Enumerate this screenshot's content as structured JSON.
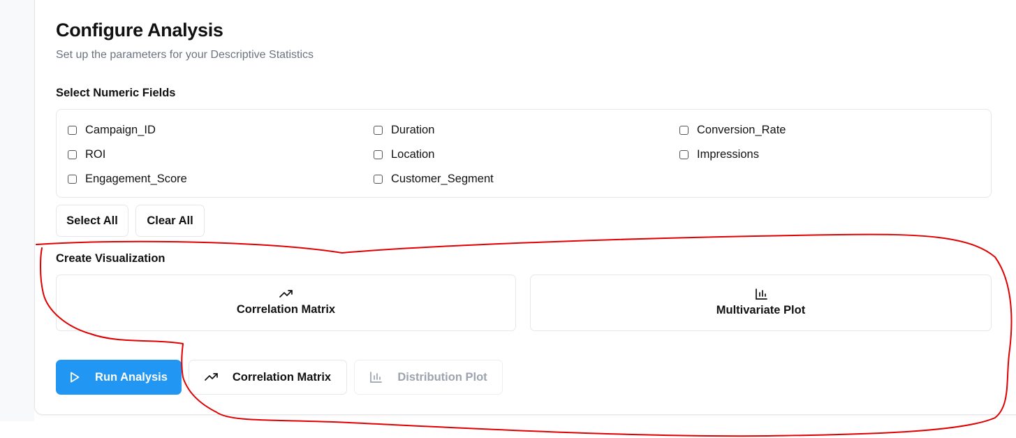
{
  "header": {
    "title": "Configure Analysis",
    "subtitle": "Set up the parameters for your Descriptive Statistics"
  },
  "fields_section": {
    "label": "Select Numeric Fields",
    "fields": [
      {
        "label": "Campaign_ID",
        "checked": false
      },
      {
        "label": "Duration",
        "checked": false
      },
      {
        "label": "Conversion_Rate",
        "checked": false
      },
      {
        "label": "ROI",
        "checked": false
      },
      {
        "label": "Location",
        "checked": false
      },
      {
        "label": "Impressions",
        "checked": false
      },
      {
        "label": "Engagement_Score",
        "checked": false
      },
      {
        "label": "Customer_Segment",
        "checked": false
      }
    ],
    "select_all_label": "Select All",
    "clear_all_label": "Clear All"
  },
  "visualization": {
    "label": "Create Visualization",
    "cards": [
      {
        "label": "Correlation Matrix",
        "icon": "trending-up-icon"
      },
      {
        "label": "Multivariate Plot",
        "icon": "bar-chart-icon"
      }
    ]
  },
  "actions": {
    "run_label": "Run Analysis",
    "correlation_label": "Correlation Matrix",
    "distribution_label": "Distribution Plot",
    "distribution_disabled": true
  },
  "colors": {
    "primary": "#2196f3",
    "annotation": "#e00000",
    "border": "#e5e7eb",
    "muted_text": "#6b7280"
  }
}
